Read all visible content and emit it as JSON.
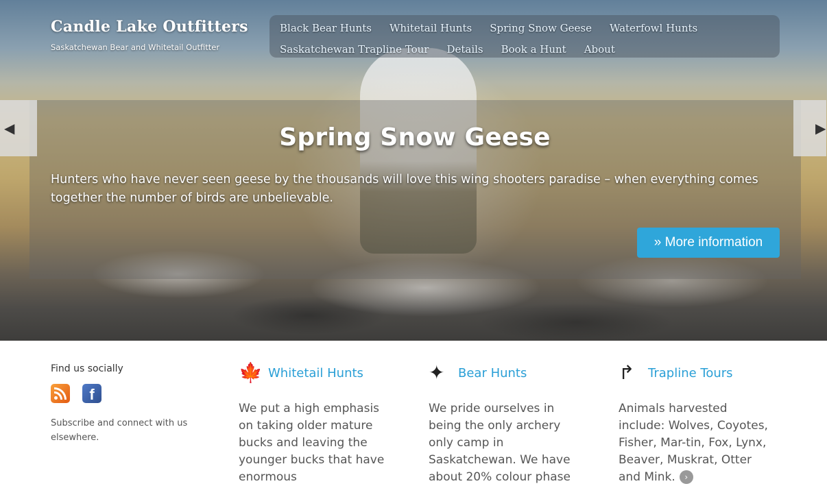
{
  "site": {
    "title": "Candle Lake Outfitters",
    "tagline": "Saskatchewan Bear and Whitetail Outfitter"
  },
  "nav": {
    "items": [
      {
        "label": "Black Bear Hunts"
      },
      {
        "label": "Whitetail Hunts"
      },
      {
        "label": "Spring Snow Geese"
      },
      {
        "label": "Waterfowl Hunts"
      },
      {
        "label": "Saskatchewan Trapline Tour"
      },
      {
        "label": "Details"
      },
      {
        "label": "Book a Hunt"
      },
      {
        "label": "About"
      }
    ]
  },
  "slider": {
    "title": "Spring Snow Geese",
    "text": "Hunters who have never seen geese by the thousands will love this wing shooters paradise – when everything comes together the number of birds are unbelievable.",
    "button_label": "» More information",
    "prev_icon": "◀",
    "next_icon": "▶"
  },
  "social": {
    "title": "Find us socially",
    "rss_icon": "rss-icon",
    "facebook_icon": "facebook-icon",
    "facebook_glyph": "f",
    "note": "Subscribe and connect with us elsewhere."
  },
  "columns": [
    {
      "title": "Whitetail Hunts",
      "icon": "maple-leaf-icon",
      "glyph": "🍁",
      "text": "We put a high emphasis on taking older mature bucks and leaving the younger bucks that have enormous"
    },
    {
      "title": "Bear Hunts",
      "icon": "sparkle-icon",
      "glyph": "✦",
      "text": "We pride ourselves in being the only archery only camp in Saskatchewan. We have about 20% colour phase"
    },
    {
      "title": "Trapline Tours",
      "icon": "curved-arrow-icon",
      "glyph": "↱",
      "text": "Animals harvested include: Wolves, Coyotes, Fisher, Mar-tin, Fox, Lynx, Beaver, Muskrat, Otter and Mink.",
      "more_glyph": "›"
    }
  ],
  "colors": {
    "accent": "#2a9fd6",
    "button": "#2fa6da"
  }
}
